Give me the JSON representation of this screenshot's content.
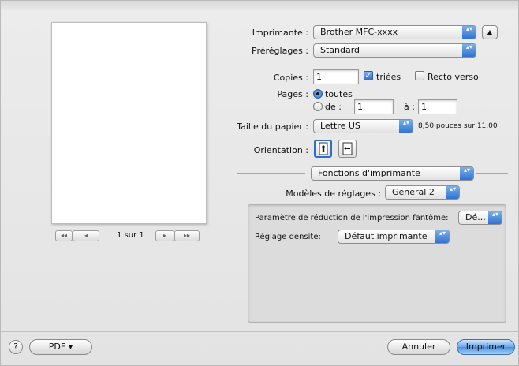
{
  "preview": {
    "first_glyph": "◂◂",
    "prev_glyph": "◂",
    "page_count": "1 sur 1",
    "next_glyph": "▸",
    "last_glyph": "▸▸"
  },
  "printer": {
    "label": "Imprimante :",
    "value": "Brother MFC-xxxx"
  },
  "presets": {
    "label": "Préréglages :",
    "value": "Standard"
  },
  "copies": {
    "label": "Copies :",
    "value": "1",
    "collated_label": "triées",
    "collated": true,
    "duplex_label": "Recto verso",
    "duplex": false
  },
  "pages": {
    "label": "Pages :",
    "all_label": "toutes",
    "from_label": "de :",
    "from_value": "1",
    "to_label": "à :",
    "to_value": "1"
  },
  "paper": {
    "label": "Taille du papier :",
    "value": "Lettre US",
    "size_text": "8,50 pouces sur 11,00"
  },
  "orientation": {
    "label": "Orientation :"
  },
  "section": {
    "value": "Fonctions d'imprimante"
  },
  "feature_sets": {
    "label": "Modèles de réglages :",
    "value": "General 2"
  },
  "panel": {
    "ghost_label": "Paramètre de réduction de l'impression fantôme:",
    "ghost_value": "Dé...",
    "density_label": "Réglage densité:",
    "density_value": "Défaut imprimante"
  },
  "footer": {
    "help": "?",
    "pdf": "PDF ▾",
    "cancel": "Annuler",
    "print": "Imprimer"
  },
  "icons": {
    "popup_arrows": "▴▾",
    "collapse": "▲"
  },
  "colors": {
    "accent": "#2d6fd0"
  }
}
